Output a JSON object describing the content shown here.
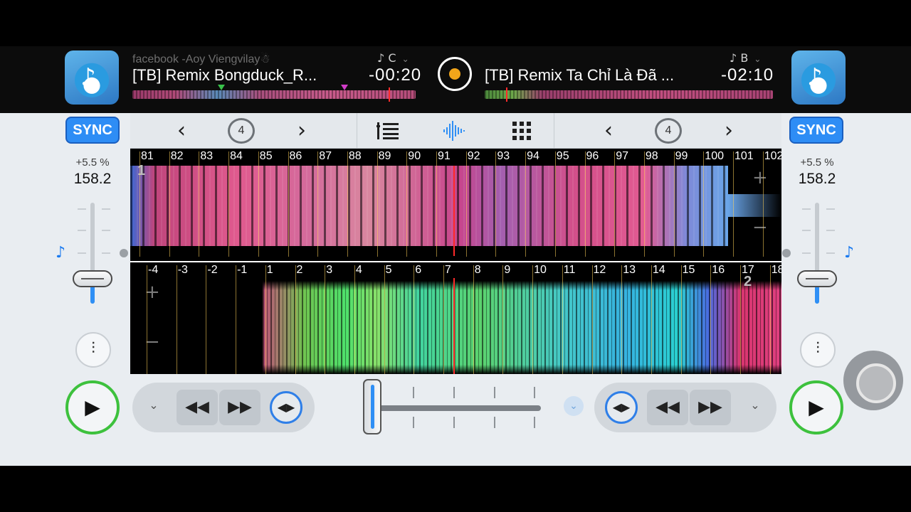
{
  "deck_a": {
    "subtitle": "facebook -Aoy Viengvilay☃",
    "title": "[TB] Remix  Bongduck_R...",
    "key_label": "C",
    "time_remaining": "-00:20",
    "sync_label": "SYNC",
    "pitch_percent": "+5.5 %",
    "bpm": "158.2",
    "loop_beats": "4",
    "beat_numbers": [
      "81",
      "82",
      "83",
      "84",
      "85",
      "86",
      "87",
      "88",
      "89",
      "90",
      "91",
      "92",
      "93",
      "94",
      "95",
      "96",
      "97",
      "98",
      "99",
      "100",
      "101",
      "102"
    ],
    "cue_number": "1",
    "progress": 0.9
  },
  "deck_b": {
    "title": "[TB] Remix Ta Chỉ Là Đã ...",
    "key_label": "B",
    "time_remaining": "-02:10",
    "sync_label": "SYNC",
    "pitch_percent": "+5.5 %",
    "bpm": "158.2",
    "loop_beats": "4",
    "beat_numbers": [
      "-4",
      "-3",
      "-2",
      "-1",
      "1",
      "2",
      "3",
      "4",
      "5",
      "6",
      "7",
      "8",
      "9",
      "10",
      "11",
      "12",
      "13",
      "14",
      "15",
      "16",
      "17",
      "18"
    ],
    "cue_number": "2",
    "progress": 0.08
  },
  "icons": {
    "note": "♪",
    "note_key": "♪",
    "chevron_left": "‹",
    "chevron_right": "›",
    "play": "▶",
    "rewind": "◀◀",
    "fast_forward": "▶▶",
    "nudge": "◀▶",
    "chevron_down": "⌄",
    "eq": "⫶",
    "plus": "+",
    "minus": "−"
  },
  "colors": {
    "accent": "#2f8ff5",
    "play_ring": "#3dc13d",
    "playhead": "#ff2a2a",
    "center_button_dot": "#f2a51a"
  }
}
